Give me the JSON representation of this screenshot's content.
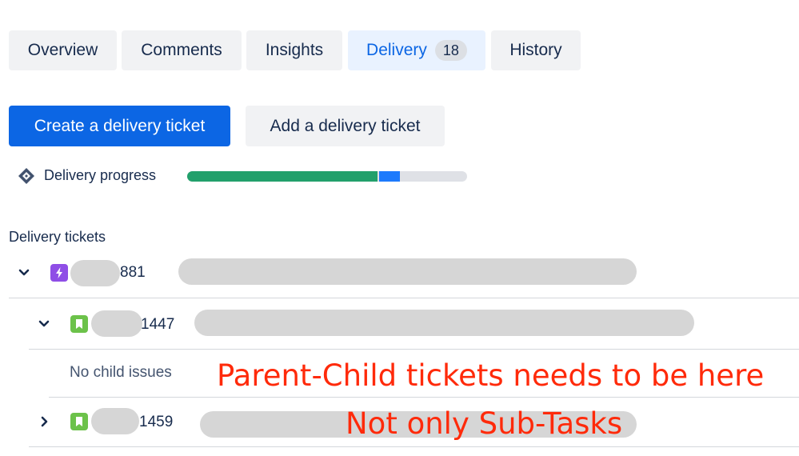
{
  "tabs": [
    {
      "label": "Overview"
    },
    {
      "label": "Comments"
    },
    {
      "label": "Insights"
    },
    {
      "label": "Delivery",
      "count": "18",
      "active": true
    },
    {
      "label": "History"
    }
  ],
  "actions": {
    "create_label": "Create a delivery ticket",
    "add_label": "Add a delivery ticket"
  },
  "progress": {
    "label": "Delivery progress",
    "done_fraction": 0.68,
    "in_progress_fraction": 0.08,
    "colors": {
      "done": "#22a06b",
      "in_progress": "#1d7afc",
      "todo": "#dfe1e6"
    }
  },
  "tickets": {
    "title": "Delivery tickets",
    "items": [
      {
        "key_suffix": "881",
        "type": "epic",
        "expanded": true
      },
      {
        "key_suffix": "1447",
        "type": "story",
        "expanded": true,
        "empty_text": "No child issues"
      },
      {
        "key_suffix": "1459",
        "type": "story",
        "expanded": false
      }
    ]
  },
  "annotations": {
    "line1": "Parent-Child tickets needs to be here",
    "line2": "Not only Sub-Tasks"
  },
  "colors": {
    "accent": "#0c66e4",
    "annotation": "#ff2a0a",
    "epic": "#8f4ee6",
    "story": "#6cc24a"
  }
}
